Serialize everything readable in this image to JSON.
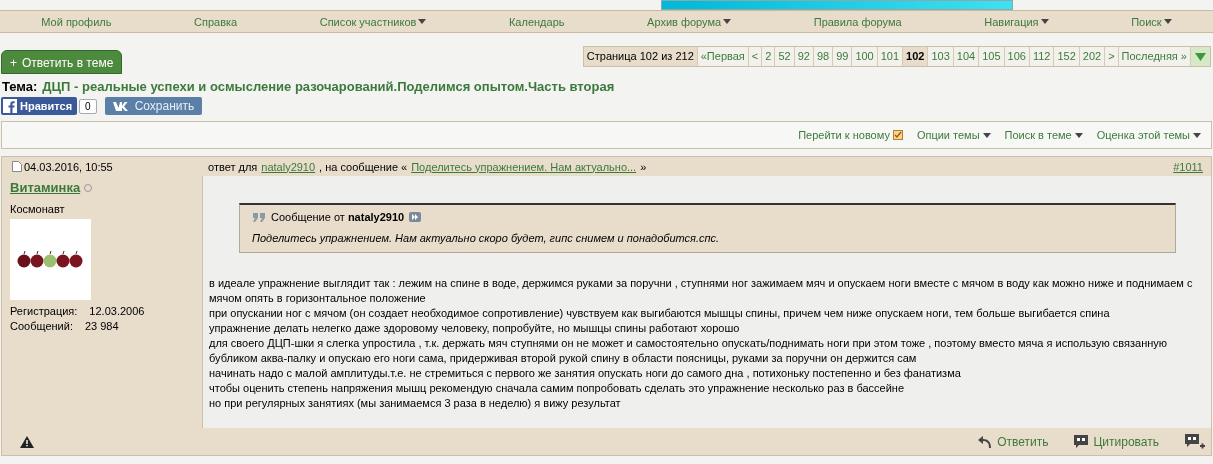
{
  "navbar": {
    "items": [
      {
        "label": "Мой профиль",
        "has_menu": false
      },
      {
        "label": "Справка",
        "has_menu": false
      },
      {
        "label": "Список участников",
        "has_menu": true
      },
      {
        "label": "Календарь",
        "has_menu": false
      },
      {
        "label": "Архив форума",
        "has_menu": true
      },
      {
        "label": "Правила форума",
        "has_menu": false
      },
      {
        "label": "Навигация",
        "has_menu": true
      },
      {
        "label": "Поиск",
        "has_menu": true
      }
    ]
  },
  "reply_button": {
    "icon": "+",
    "label": "Ответить в теме"
  },
  "pagination": [
    {
      "kind": "label",
      "label": "Страница 102 из 212"
    },
    {
      "kind": "link",
      "label": "«Первая",
      "selected": false
    },
    {
      "kind": "link",
      "label": "<",
      "selected": false
    },
    {
      "kind": "link",
      "label": "2",
      "selected": false
    },
    {
      "kind": "link",
      "label": "52",
      "selected": false
    },
    {
      "kind": "link",
      "label": "92",
      "selected": false
    },
    {
      "kind": "link",
      "label": "98",
      "selected": false
    },
    {
      "kind": "link",
      "label": "99",
      "selected": false
    },
    {
      "kind": "link",
      "label": "100",
      "selected": false
    },
    {
      "kind": "link",
      "label": "101",
      "selected": false
    },
    {
      "kind": "link",
      "label": "102",
      "selected": true
    },
    {
      "kind": "link",
      "label": "103",
      "selected": false
    },
    {
      "kind": "link",
      "label": "104",
      "selected": false
    },
    {
      "kind": "link",
      "label": "105",
      "selected": false
    },
    {
      "kind": "link",
      "label": "106",
      "selected": false
    },
    {
      "kind": "link",
      "label": "112",
      "selected": false
    },
    {
      "kind": "link",
      "label": "152",
      "selected": false
    },
    {
      "kind": "link",
      "label": "202",
      "selected": false
    },
    {
      "kind": "link",
      "label": ">",
      "selected": false
    },
    {
      "kind": "link",
      "label": "Последняя »",
      "selected": false
    },
    {
      "kind": "menu"
    }
  ],
  "thread": {
    "prefix": "Тема:",
    "title": "ДЦП - реальные успехи и осмысление разочарований.Поделимся опытом.Часть вторая"
  },
  "social": {
    "like_label": "Нравится",
    "like_count": "0",
    "vk_label": "Сохранить"
  },
  "thread_tools": [
    {
      "label": "Перейти к новому",
      "kind": "new"
    },
    {
      "label": "Опции темы",
      "kind": "menu"
    },
    {
      "label": "Поиск в теме",
      "kind": "menu"
    },
    {
      "label": "Оценка этой темы",
      "kind": "menu"
    }
  ],
  "post": {
    "date": "04.03.2016, 10:55",
    "reply_prefix": "ответ для",
    "reply_to": "nataly2910",
    "reply_mid": ", на сообщение «",
    "reply_link": "Поделитесь упражнением. Нам актуально...",
    "reply_suffix": "»",
    "number": "#1011",
    "author": {
      "name": "Витаминка",
      "online": false,
      "rank": "Космонавт",
      "reg_label": "Регистрация:",
      "reg_value": "12.03.2006",
      "posts_label": "Сообщений:",
      "posts_value": "23 984"
    },
    "quote": {
      "prefix": "Сообщение от",
      "author": "nataly2910",
      "text": "Поделитесь упражнением. Нам актуально скоро будет, гипс снимем и понадобится.спс."
    },
    "lines": [
      "в идеале упражнение выглядит так : лежим на спине в воде, держимся руками за поручни , ступнями ног зажимаем мяч и опускаем ноги вместе с мячом в воду как можно ниже и поднимаем с мячом опять в горизонтальное положение",
      "при опускании ног с мячом (он создает необходимое сопротивление) чувствуем как выгибаются мышцы спины, причем чем ниже опускаем ноги, тем больше выгибается спина",
      "упражнение делать нелегко даже здоровому человеку, попробуйте, но мышцы спины работают хорошо",
      "для своего ДЦП-шки я слегка упростила , т.к. держать мяч ступнями он не может и самостоятельно опускать/поднимать ноги при этом тоже , поэтому вместо мяча я использую связанную бубликом аква-палку и опускаю его ноги сама, придерживая второй рукой спину в области поясницы, руками за поручни он держится сам",
      "начинать надо с малой амплитуды.т.е. не стремиться с первого же занятия опускать ноги до самого дна , потихоньку постепенно и без фанатизма",
      "чтобы оценить степень напряжения мышц рекомендую сначала самим попробовать сделать это упражнение несколько раз в бассейне",
      "но при регулярных занятиях (мы занимаемся 3 раза в неделю) я вижу результат"
    ],
    "actions": [
      {
        "kind": "reply",
        "label": "Ответить"
      },
      {
        "kind": "quote",
        "label": "Цитировать"
      },
      {
        "kind": "multiquote"
      }
    ]
  }
}
